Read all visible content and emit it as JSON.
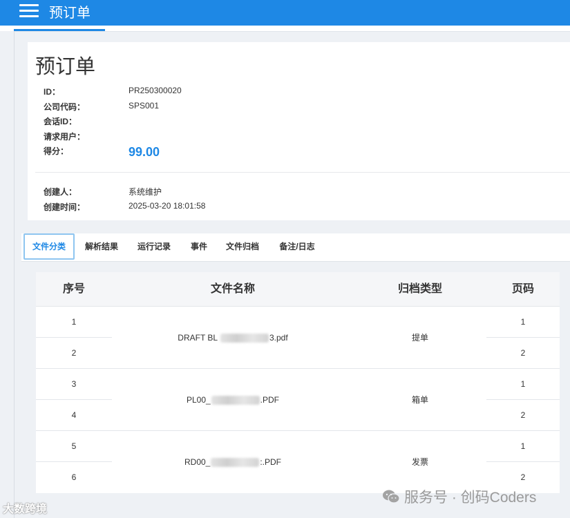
{
  "topbar": {
    "title": "预订单",
    "menu_icon": "hamburger-menu-icon",
    "color": "#1e88e5"
  },
  "record": {
    "page_title": "预订单",
    "fields": [
      {
        "label": "ID：",
        "value": "PR250300020"
      },
      {
        "label": "公司代码：",
        "value": "SPS001"
      },
      {
        "label": "会话ID：",
        "value": ""
      },
      {
        "label": "请求用户：",
        "value": ""
      },
      {
        "label": "得分：",
        "value": "99.00"
      }
    ],
    "meta": [
      {
        "label": "创建人：",
        "value": "系统维护"
      },
      {
        "label": "创建时间：",
        "value": "2025-03-20 18:01:58"
      }
    ],
    "score_color": "#1e88e5"
  },
  "tabs": [
    {
      "label": "文件分类",
      "active": true
    },
    {
      "label": "解析结果",
      "active": false
    },
    {
      "label": "运行记录",
      "active": false
    },
    {
      "label": "事件",
      "active": false
    },
    {
      "label": "文件归档",
      "active": false
    },
    {
      "label": "备注/日志",
      "active": false
    }
  ],
  "table": {
    "headers": [
      "序号",
      "文件名称",
      "归档类型",
      "页码"
    ],
    "rows": [
      {
        "seq": "1",
        "page": "1"
      },
      {
        "seq": "2",
        "page": "2"
      },
      {
        "seq": "3",
        "page": "1"
      },
      {
        "seq": "4",
        "page": "2"
      },
      {
        "seq": "5",
        "page": "1"
      },
      {
        "seq": "6",
        "page": "2"
      }
    ],
    "files": [
      {
        "name_prefix": "DRAFT BL ",
        "name_suffix": "3.pdf",
        "type": "提单"
      },
      {
        "name_prefix": "PL00_",
        "name_suffix": ".PDF",
        "type": "箱单"
      },
      {
        "name_prefix": "RD00_",
        "name_suffix": ":.PDF",
        "type": "发票"
      }
    ]
  },
  "watermarks": {
    "left": "大数跨境",
    "right": "服务号 · 创码Coders",
    "right_icon": "wechat-icon"
  }
}
